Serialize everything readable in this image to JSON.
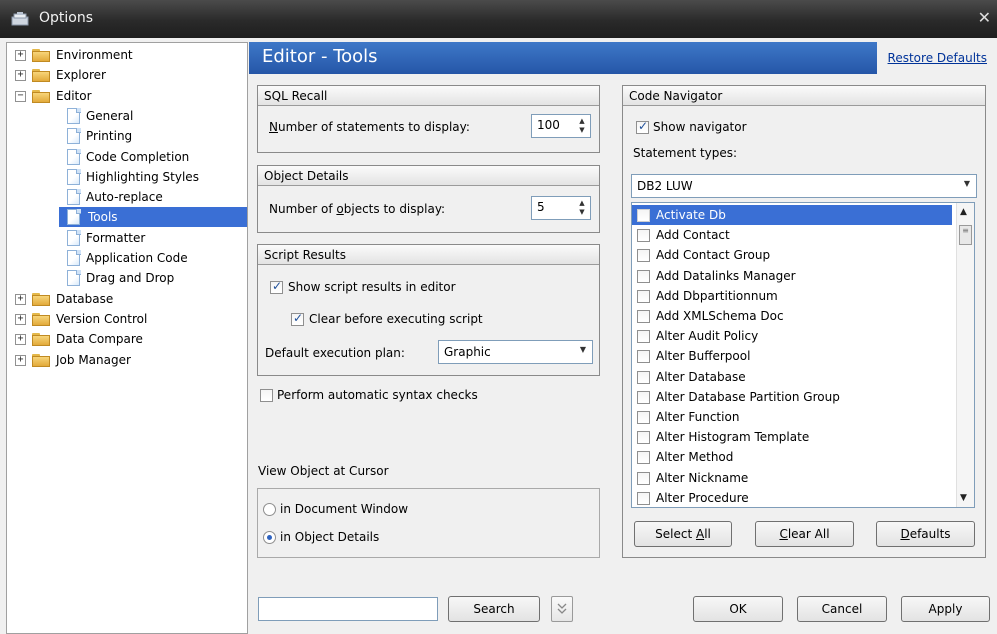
{
  "window": {
    "title": "Options",
    "close_glyph": "✕"
  },
  "tree": {
    "items": [
      {
        "label": "Environment",
        "kind": "folder",
        "expander": "+",
        "level": 0
      },
      {
        "label": "Explorer",
        "kind": "folder",
        "expander": "+",
        "level": 0
      },
      {
        "label": "Editor",
        "kind": "folder-open",
        "expander": "−",
        "level": 0
      },
      {
        "label": "General",
        "kind": "page",
        "level": 1
      },
      {
        "label": "Printing",
        "kind": "page",
        "level": 1
      },
      {
        "label": "Code Completion",
        "kind": "page",
        "level": 1
      },
      {
        "label": "Highlighting Styles",
        "kind": "page",
        "level": 1
      },
      {
        "label": "Auto-replace",
        "kind": "page",
        "level": 1
      },
      {
        "label": "Tools",
        "kind": "page",
        "level": 1,
        "selected": true
      },
      {
        "label": "Formatter",
        "kind": "page",
        "level": 1
      },
      {
        "label": "Application Code",
        "kind": "page",
        "level": 1
      },
      {
        "label": "Drag and Drop",
        "kind": "page",
        "level": 1
      },
      {
        "label": "Database",
        "kind": "folder",
        "expander": "+",
        "level": 0
      },
      {
        "label": "Version Control",
        "kind": "folder",
        "expander": "+",
        "level": 0
      },
      {
        "label": "Data Compare",
        "kind": "folder",
        "expander": "+",
        "level": 0
      },
      {
        "label": "Job Manager",
        "kind": "folder",
        "expander": "+",
        "level": 0
      }
    ]
  },
  "header": {
    "title": "Editor - Tools",
    "restore_defaults": "Restore Defaults"
  },
  "sql_recall": {
    "title": "SQL Recall",
    "label_pre": "",
    "label_u": "N",
    "label_post": "umber of statements to display:",
    "value": "100"
  },
  "object_details": {
    "title": "Object Details",
    "label_pre": "Number of ",
    "label_u": "o",
    "label_post": "bjects to display:",
    "value": "5"
  },
  "script_results": {
    "title": "Script Results",
    "show_results": {
      "label": "Show script results in editor",
      "checked": true
    },
    "clear_before": {
      "label": "Clear before executing script",
      "checked": true
    },
    "plan_label": "Default execution plan:",
    "plan_value": "Graphic"
  },
  "syntax_checks": {
    "label": "Perform automatic syntax checks",
    "checked": false
  },
  "view_object": {
    "title": "View Object at Cursor",
    "options": [
      {
        "label": "in Document Window",
        "checked": false
      },
      {
        "label": "in Object Details",
        "checked": true
      }
    ]
  },
  "code_navigator": {
    "title": "Code Navigator",
    "show_navigator": {
      "label": "Show navigator",
      "checked": true
    },
    "statement_types_label": "Statement types:",
    "db_value": "DB2 LUW",
    "statements": [
      {
        "label": "Activate Db",
        "checked": false,
        "selected": true
      },
      {
        "label": "Add Contact",
        "checked": false
      },
      {
        "label": "Add Contact Group",
        "checked": false
      },
      {
        "label": "Add Datalinks Manager",
        "checked": false
      },
      {
        "label": "Add Dbpartitionnum",
        "checked": false
      },
      {
        "label": "Add XMLSchema Doc",
        "checked": false
      },
      {
        "label": "Alter Audit Policy",
        "checked": false
      },
      {
        "label": "Alter Bufferpool",
        "checked": false
      },
      {
        "label": "Alter Database",
        "checked": false
      },
      {
        "label": "Alter Database Partition Group",
        "checked": false
      },
      {
        "label": "Alter Function",
        "checked": false
      },
      {
        "label": "Alter Histogram Template",
        "checked": false
      },
      {
        "label": "Alter Method",
        "checked": false
      },
      {
        "label": "Alter Nickname",
        "checked": false
      },
      {
        "label": "Alter Procedure",
        "checked": false
      }
    ],
    "select_all": {
      "pre": "Select ",
      "u": "A",
      "post": "ll"
    },
    "clear_all": {
      "pre": "",
      "u": "C",
      "post": "lear All"
    },
    "defaults": {
      "pre": "",
      "u": "D",
      "post": "efaults"
    }
  },
  "footer": {
    "search_value": "",
    "search_button": "Search",
    "ok": "OK",
    "cancel": "Cancel",
    "apply": "Apply"
  },
  "icons": {
    "window": "options-window-icon",
    "close": "close-icon",
    "folder": "folder-icon",
    "page": "page-icon",
    "expand": "expander-icon",
    "chevron": "chevron-down-icon"
  },
  "colors": {
    "header_bg": "#2f66b8",
    "selection": "#3a6fd5",
    "link": "#003399"
  }
}
